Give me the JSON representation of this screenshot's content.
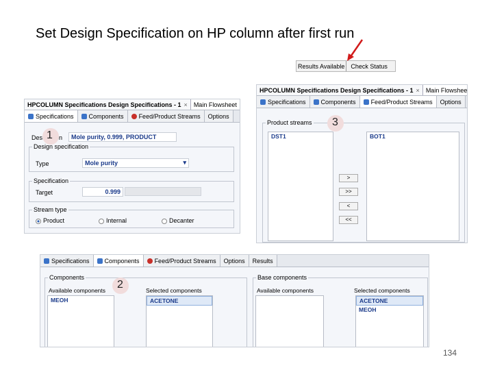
{
  "slide": {
    "title": "Set Design Specification on HP column after first run",
    "page_number": "134"
  },
  "results_bar": {
    "results_label": "Results Available",
    "check_status_label": "Check Status"
  },
  "markers": {
    "m1": "1",
    "m2": "2",
    "m3": "3"
  },
  "panel1": {
    "title_active": "HPCOLUMN Specifications Design Specifications - 1",
    "title_other": "Main Flowsheet",
    "close": "×",
    "tabs": [
      "Specifications",
      "Components",
      "Feed/Product Streams",
      "Options"
    ],
    "description_label": "Description",
    "description_value": "Mole purity, 0.999, PRODUCT",
    "design_spec_legend": "Design specification",
    "type_label": "Type",
    "type_value": "Mole purity",
    "specification_legend": "Specification",
    "target_label": "Target",
    "target_value": "0.999",
    "stream_type_legend": "Stream type",
    "stream_type_options": [
      "Product",
      "Internal",
      "Decanter"
    ],
    "stream_type_selected": "Product"
  },
  "panel3": {
    "title_active": "HPCOLUMN Specifications Design Specifications - 1",
    "title_other": "Main Flowsheet",
    "close": "×",
    "tabs": [
      "Specifications",
      "Components",
      "Feed/Product Streams",
      "Options"
    ],
    "product_streams_legend": "Product streams",
    "available": [
      "DST1"
    ],
    "selected": [
      "BOT1"
    ],
    "move_buttons": [
      ">",
      ">>",
      "<",
      "<<"
    ]
  },
  "panel2": {
    "tabs": [
      "Specifications",
      "Components",
      "Feed/Product Streams",
      "Options",
      "Results"
    ],
    "components_legend": "Components",
    "available_label": "Available components",
    "selected_label": "Selected components",
    "available": [
      "MEOH"
    ],
    "selected": [
      "ACETONE"
    ],
    "base_components_legend": "Base components",
    "base_available_label": "Available components",
    "base_selected_label": "Selected components",
    "base_available": [],
    "base_selected": [
      "ACETONE",
      "MEOH"
    ]
  }
}
